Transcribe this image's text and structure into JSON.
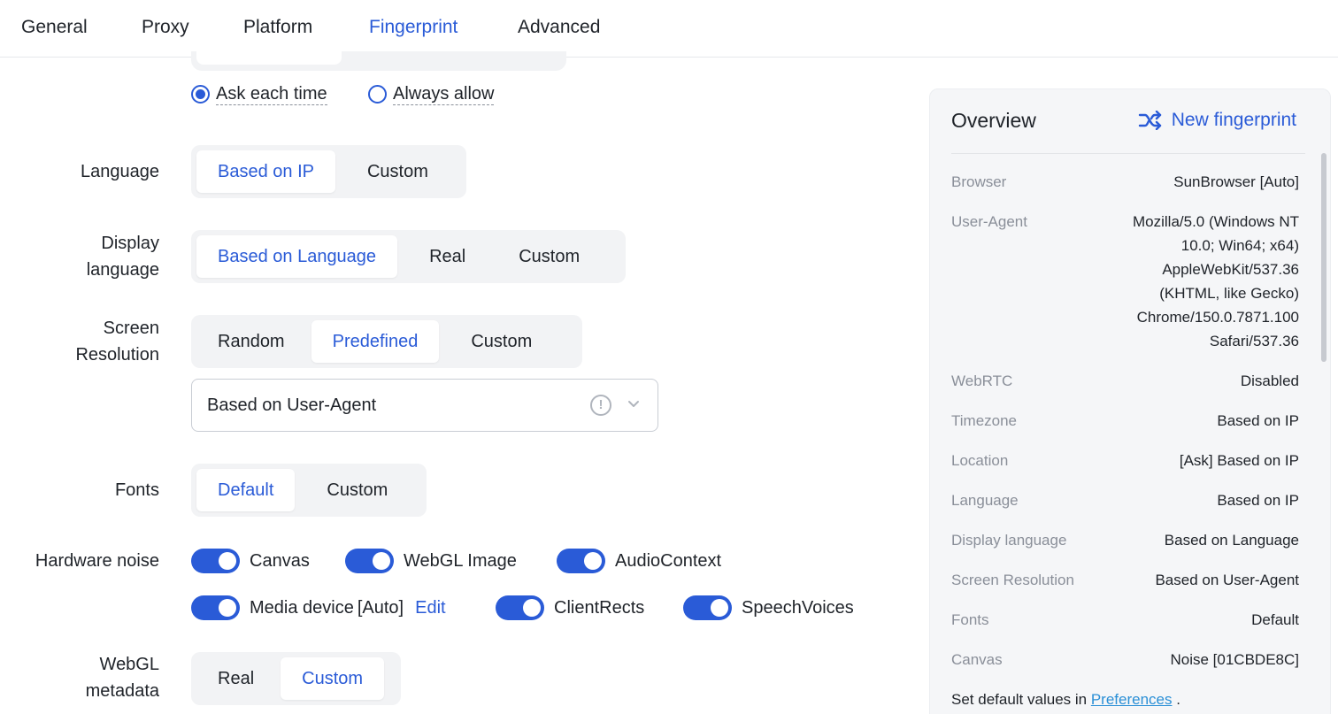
{
  "tabs": [
    {
      "label": "General"
    },
    {
      "label": "Proxy"
    },
    {
      "label": "Platform"
    },
    {
      "label": "Fingerprint",
      "active": true
    },
    {
      "label": "Advanced"
    }
  ],
  "location_prompt": {
    "ask_each_time": "Ask each time",
    "always_allow": "Always allow",
    "selected": "ask_each_time"
  },
  "language": {
    "label": "Language",
    "options": [
      "Based on IP",
      "Custom"
    ],
    "selected": "Based on IP"
  },
  "display_language": {
    "label_line1": "Display",
    "label_line2": "language",
    "options": [
      "Based on Language",
      "Real",
      "Custom"
    ],
    "selected": "Based on Language"
  },
  "screen_resolution": {
    "label_line1": "Screen",
    "label_line2": "Resolution",
    "options": [
      "Random",
      "Predefined",
      "Custom"
    ],
    "selected": "Predefined",
    "dropdown_value": "Based on User-Agent"
  },
  "fonts": {
    "label": "Fonts",
    "options": [
      "Default",
      "Custom"
    ],
    "selected": "Default"
  },
  "hardware_noise": {
    "label": "Hardware noise",
    "toggles": [
      {
        "label": "Canvas",
        "on": true
      },
      {
        "label": "WebGL Image",
        "on": true
      },
      {
        "label": "AudioContext",
        "on": true
      },
      {
        "label": "Media device",
        "suffix": "[Auto]",
        "on": true
      },
      {
        "label": "ClientRects",
        "on": true
      },
      {
        "label": "SpeechVoices",
        "on": true
      }
    ],
    "edit_label": "Edit"
  },
  "webgl_metadata": {
    "label_line1": "WebGL",
    "label_line2": "metadata",
    "options": [
      "Real",
      "Custom"
    ],
    "selected": "Custom"
  },
  "overview": {
    "title": "Overview",
    "new_fingerprint": "New fingerprint",
    "rows": [
      {
        "key": "Browser",
        "value": "SunBrowser [Auto]"
      },
      {
        "key": "User-Agent",
        "value_lines": [
          "Mozilla/5.0 (Windows NT",
          "10.0; Win64; x64)",
          "AppleWebKit/537.36",
          "(KHTML, like Gecko)",
          "Chrome/150.0.7871.100",
          "Safari/537.36"
        ]
      },
      {
        "key": "WebRTC",
        "value": "Disabled"
      },
      {
        "key": "Timezone",
        "value": "Based on IP"
      },
      {
        "key": "Location",
        "value": "[Ask] Based on IP"
      },
      {
        "key": "Language",
        "value": "Based on IP"
      },
      {
        "key": "Display language",
        "value": "Based on Language"
      },
      {
        "key": "Screen Resolution",
        "value": "Based on User-Agent"
      },
      {
        "key": "Fonts",
        "value": "Default"
      },
      {
        "key": "Canvas",
        "value": "Noise [01CBDE8C]"
      }
    ],
    "footer_text": "Set default values in",
    "footer_link": "Preferences",
    "footer_end": "."
  },
  "colors": {
    "accent": "#2a5bd7",
    "link": "#2a8fd6",
    "segment_bg": "#f2f3f5",
    "panel_bg": "#f5f6f8"
  },
  "icons": {
    "new_fingerprint": "shuffle-icon",
    "dropdown": "chevron-down-icon",
    "warning": "info-circle-icon"
  }
}
